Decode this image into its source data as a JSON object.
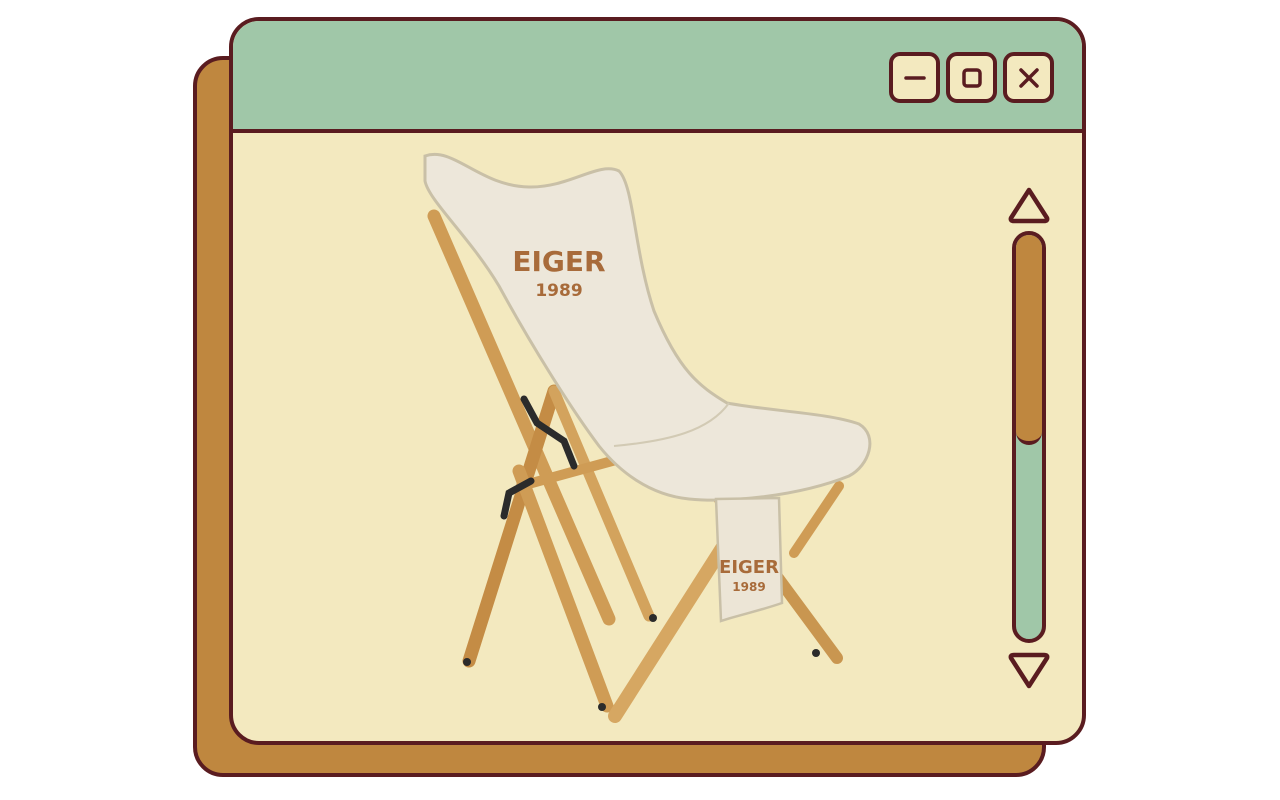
{
  "window": {
    "controls": {
      "minimize_icon": "minimize-icon",
      "maximize_icon": "maximize-icon",
      "close_icon": "close-icon"
    },
    "scrollbar": {
      "up_icon": "triangle-up-icon",
      "down_icon": "triangle-down-icon",
      "position_fraction": 0.52
    }
  },
  "image": {
    "subject": "folding-camp-chair",
    "brand": "EIGER",
    "year": "1989",
    "pocket_brand": "EIGER",
    "pocket_year": "1989"
  },
  "colors": {
    "outline": "#5a1c20",
    "titlebar": "#a0c7a8",
    "window_body": "#f3e9bf",
    "shadow_window": "#bf873f",
    "scroll_thumb": "#bf873f",
    "scroll_track": "#a0c7a8"
  }
}
